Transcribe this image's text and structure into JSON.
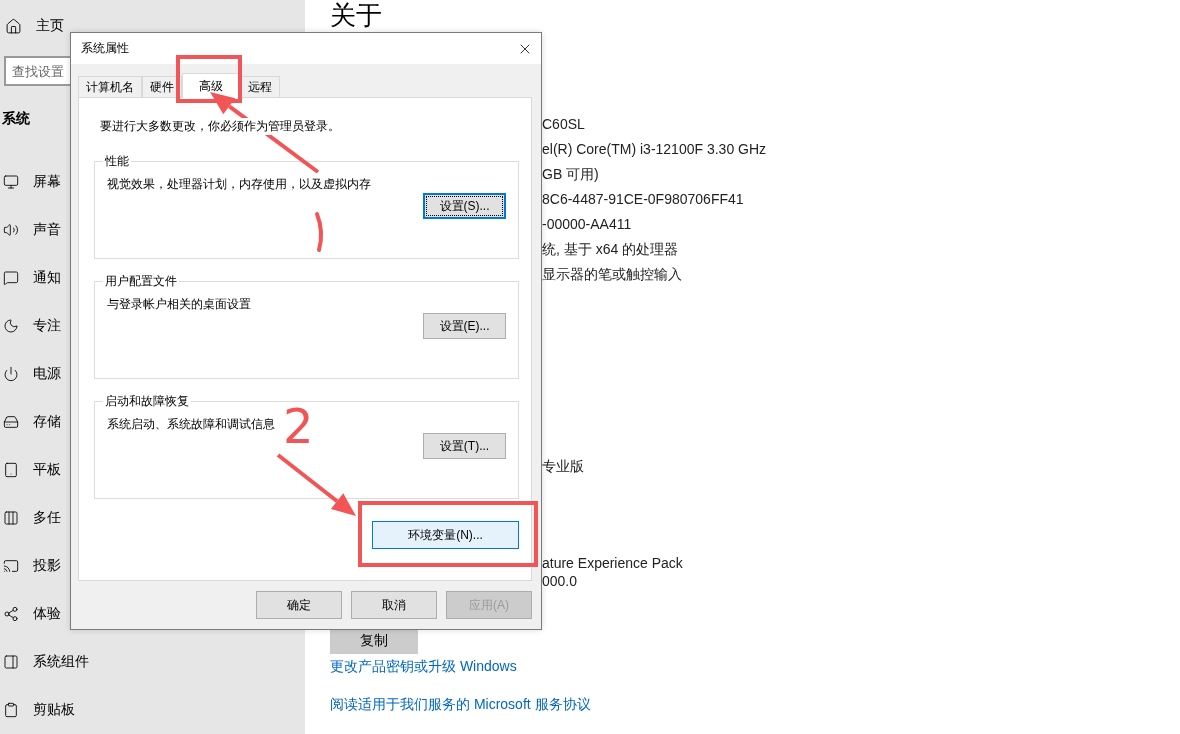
{
  "settings": {
    "home": "主页",
    "search": {
      "placeholder": "查找设置"
    },
    "section": "系统",
    "nav_items": [
      {
        "label": "屏幕"
      },
      {
        "label": "声音"
      },
      {
        "label": "通知"
      },
      {
        "label": "专注"
      },
      {
        "label": "电源"
      },
      {
        "label": "存储"
      },
      {
        "label": "平板"
      },
      {
        "label": "多任"
      },
      {
        "label": "投影"
      },
      {
        "label": "体验"
      },
      {
        "label": "系统组件"
      },
      {
        "label": "剪贴板"
      }
    ],
    "page_title": "关于",
    "spec_lines": [
      "C60SL",
      "el(R) Core(TM) i3-12100F   3.30 GHz",
      "GB 可用)",
      "8C6-4487-91CE-0F980706FF41",
      "-00000-AA411",
      "统, 基于 x64 的处理器",
      "显示器的笔或触控输入"
    ],
    "edition": "专业版",
    "experience_lines": [
      "ature Experience Pack",
      "000.0"
    ],
    "copy_button": "复制",
    "links": [
      "更改产品密钥或升级 Windows",
      "阅读适用于我们服务的 Microsoft 服务协议"
    ]
  },
  "dialog": {
    "title": "系统属性",
    "tabs": [
      {
        "label": "计算机名",
        "selected": false
      },
      {
        "label": "硬件",
        "selected": false
      },
      {
        "label": "高级",
        "selected": true
      },
      {
        "label": "远程",
        "selected": false
      }
    ],
    "admin_note": "要进行大多数更改，你必须作为管理员登录。",
    "groups": [
      {
        "title": "性能",
        "description": "视觉效果，处理器计划，内存使用，以及虚拟内存",
        "button": {
          "label": "设置(S)...",
          "focused": true
        }
      },
      {
        "title": "用户配置文件",
        "description": "与登录帐户相关的桌面设置",
        "button": {
          "label": "设置(E)...",
          "focused": false
        }
      },
      {
        "title": "启动和故障恢复",
        "description": "系统启动、系统故障和调试信息",
        "button": {
          "label": "设置(T)...",
          "focused": false
        }
      }
    ],
    "env_button": {
      "label": "环境变量(N)...",
      "hovered": true
    },
    "footer_buttons": [
      {
        "label": "确定",
        "disabled": false
      },
      {
        "label": "取消",
        "disabled": false
      },
      {
        "label": "应用(A)",
        "disabled": true
      }
    ]
  },
  "annotations": [
    {
      "kind": "frame"
    },
    {
      "kind": "arrow"
    },
    {
      "kind": "stroke"
    },
    {
      "kind": "number",
      "text": "2"
    },
    {
      "kind": "arrow"
    },
    {
      "kind": "frame"
    }
  ]
}
